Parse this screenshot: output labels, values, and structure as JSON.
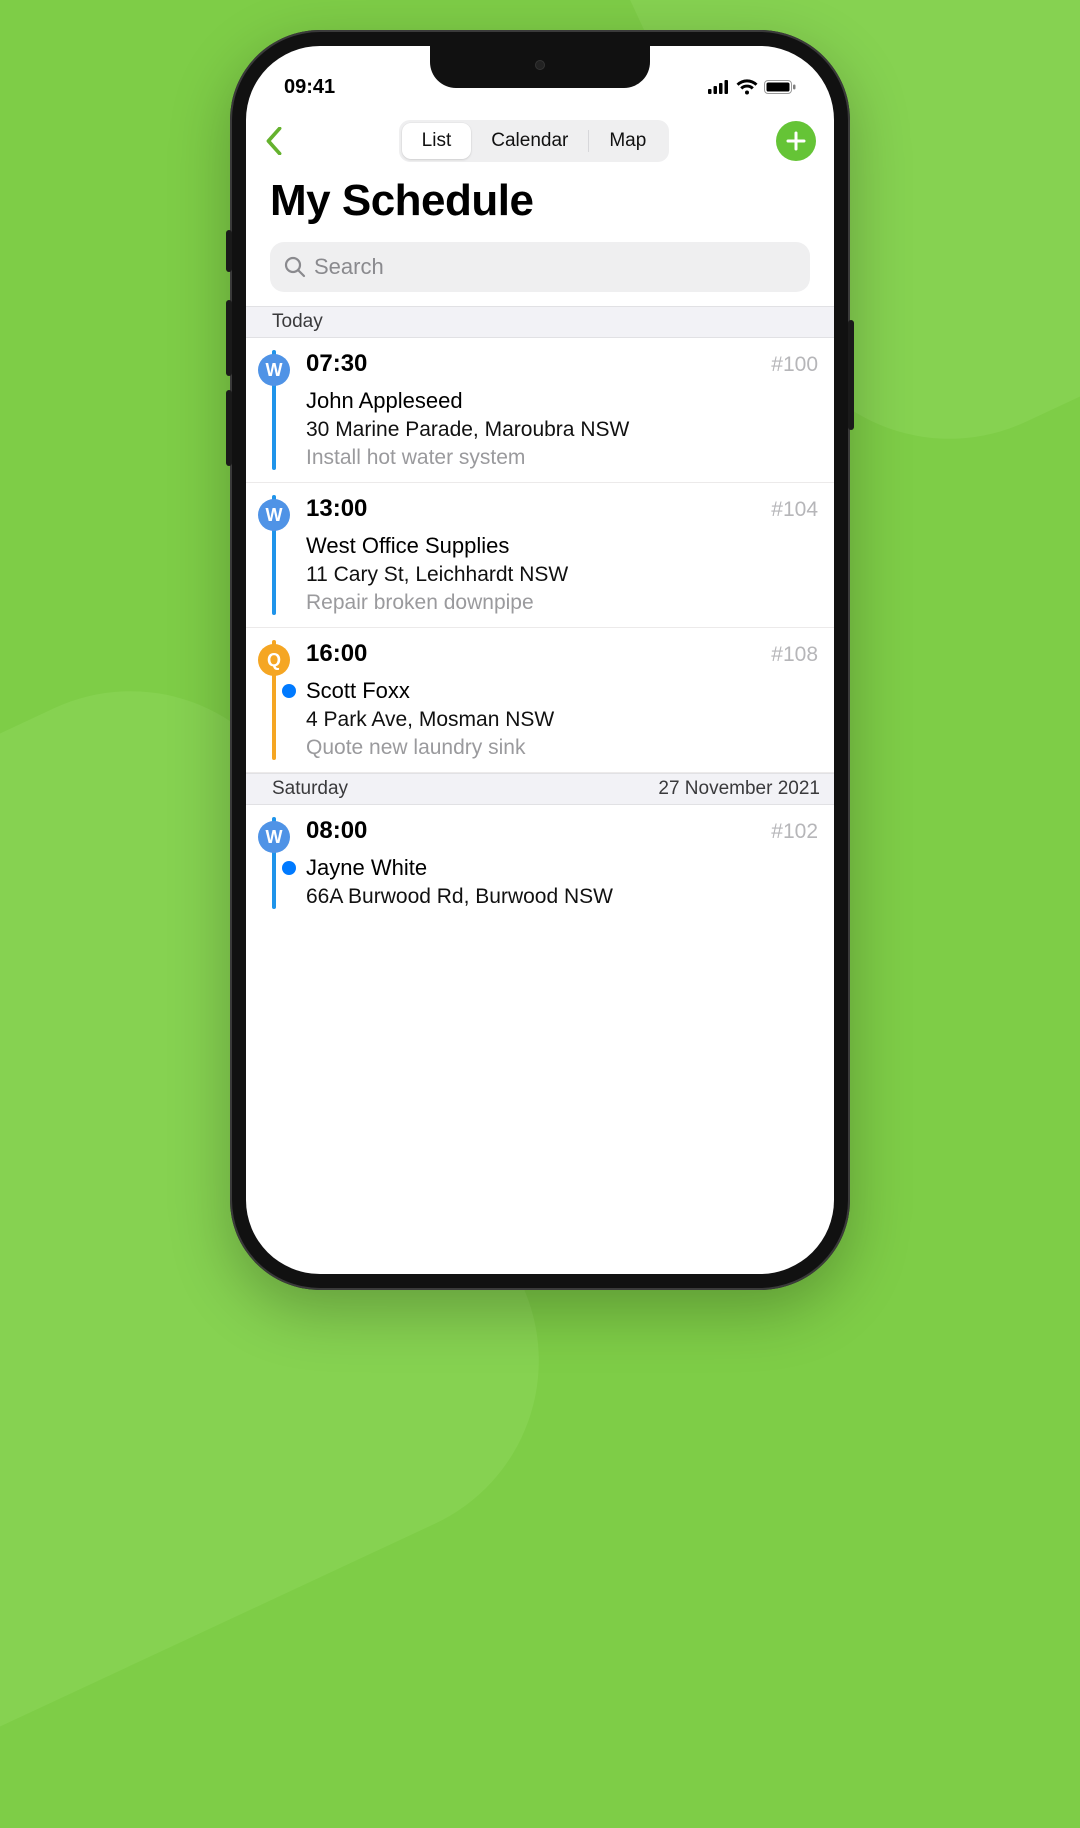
{
  "statusbar": {
    "time": "09:41"
  },
  "nav": {
    "tabs": {
      "list": "List",
      "calendar": "Calendar",
      "map": "Map"
    }
  },
  "title": "My Schedule",
  "search": {
    "placeholder": "Search"
  },
  "sections": [
    {
      "label": "Today",
      "date": "",
      "items": [
        {
          "badge": "W",
          "badgeColor": "blue",
          "lineColor": "blue",
          "time": "07:30",
          "id": "#100",
          "name": "John Appleseed",
          "address": "30 Marine Parade, Maroubra NSW",
          "desc": "Install hot water system",
          "dot": false
        },
        {
          "badge": "W",
          "badgeColor": "blue",
          "lineColor": "blue",
          "time": "13:00",
          "id": "#104",
          "name": "West Office Supplies",
          "address": "11 Cary St, Leichhardt NSW",
          "desc": "Repair broken downpipe",
          "dot": false
        },
        {
          "badge": "Q",
          "badgeColor": "orange",
          "lineColor": "orange",
          "time": "16:00",
          "id": "#108",
          "name": "Scott Foxx",
          "address": "4 Park Ave, Mosman NSW",
          "desc": "Quote new laundry sink",
          "dot": true
        }
      ]
    },
    {
      "label": "Saturday",
      "date": "27 November 2021",
      "items": [
        {
          "badge": "W",
          "badgeColor": "blue",
          "lineColor": "blue",
          "time": "08:00",
          "id": "#102",
          "name": "Jayne White",
          "address": "66A Burwood Rd, Burwood NSW",
          "desc": "",
          "dot": true
        }
      ]
    }
  ]
}
